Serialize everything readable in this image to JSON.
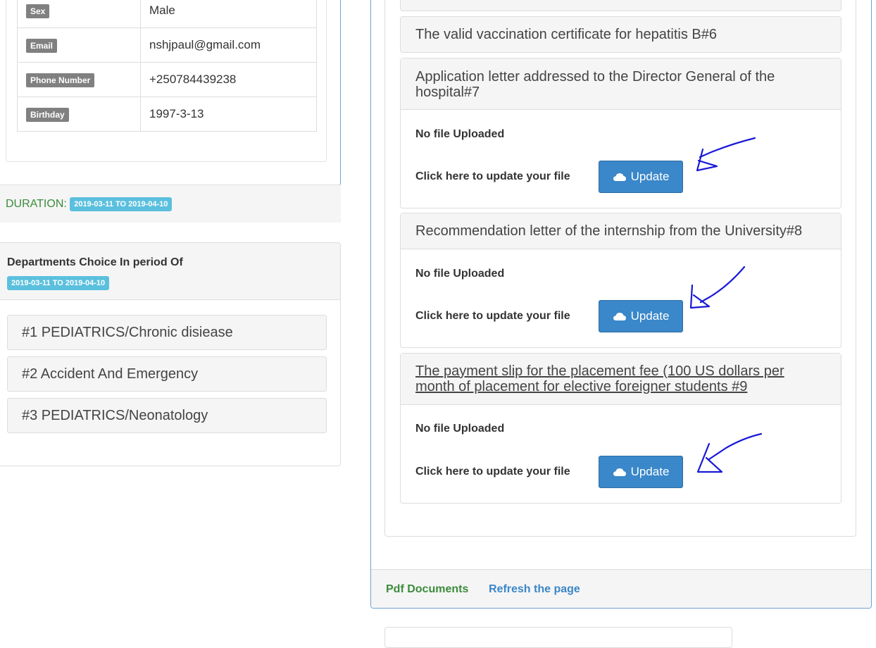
{
  "profile": {
    "rows": [
      {
        "key": "Sex",
        "value": "Male"
      },
      {
        "key": "Email",
        "value": "nshjpaul@gmail.com"
      },
      {
        "key": "Phone Number",
        "value": "+250784439238"
      },
      {
        "key": "Birthday",
        "value": "1997-3-13"
      }
    ],
    "duration_label": "DURATION:",
    "duration_value": "2019-03-11 TO 2019-04-10"
  },
  "departments": {
    "title": "Departments Choice In period Of",
    "period": "2019-03-11 TO 2019-04-10",
    "items": [
      "#1 PEDIATRICS/Chronic disiease",
      "#2 Accident And Emergency",
      "#3 PEDIATRICS/Neonatology"
    ]
  },
  "documents": {
    "items": [
      {
        "title": "The valid vaccination certificate for hepatitis B#6"
      },
      {
        "title": "Application letter addressed to the Director General of the hospital#7",
        "status": "No file Uploaded",
        "prompt": "Click here to update your file",
        "button": "Update"
      },
      {
        "title": "Recommendation letter of the internship from the University#8",
        "status": "No file Uploaded",
        "prompt": "Click here to update your file",
        "button": "Update"
      },
      {
        "title": "The payment slip for the placement fee (100 US dollars per month of placement for elective foreigner students #9",
        "status": "No file Uploaded",
        "prompt": "Click here to update your file",
        "button": "Update"
      }
    ],
    "footer_pdf": "Pdf Documents",
    "footer_refresh": "Refresh the page"
  },
  "colors": {
    "panel_border": "#6fa2d6",
    "button_primary": "#3a87c9",
    "badge_info": "#5bc0de",
    "success_text": "#3c8b3c",
    "annotation_ink": "#1a1ad6"
  },
  "icons": {
    "update": "cloud-icon",
    "annotation": "hand-drawn-arrow-icon"
  }
}
